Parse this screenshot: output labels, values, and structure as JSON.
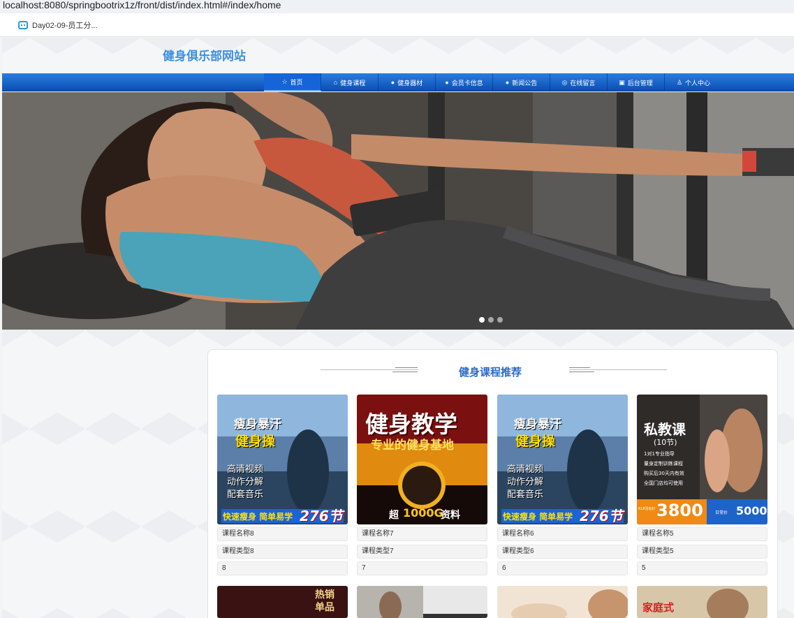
{
  "browser": {
    "url": "localhost:8080/springbootrix1z/front/dist/index.html#/index/home",
    "bookmark": "Day02-09-员工分..."
  },
  "site": {
    "title": "健身俱乐部网站"
  },
  "nav": [
    {
      "label": "首页",
      "icon": "star-icon"
    },
    {
      "label": "健身课程",
      "icon": "bag-icon"
    },
    {
      "label": "健身器材",
      "icon": "info-icon"
    },
    {
      "label": "会员卡信息",
      "icon": "question-icon"
    },
    {
      "label": "新闻公告",
      "icon": "info-icon"
    },
    {
      "label": "在线留言",
      "icon": "chat-icon"
    },
    {
      "label": "后台管理",
      "icon": "briefcase-icon"
    },
    {
      "label": "个人中心",
      "icon": "user-icon"
    }
  ],
  "carousel": {
    "dots": 3,
    "active_index": 0
  },
  "section": {
    "title": "健身课程推荐"
  },
  "courses": [
    {
      "name": "课程名称8",
      "type": "课程类型8",
      "value": "8",
      "poster": {
        "t1": "瘦身暴汗",
        "t2": "健身操",
        "t3": "高清视频",
        "t4": "动作分解",
        "t5": "配套音乐",
        "t6": "快速瘦身  简单易学",
        "t7": "276节"
      }
    },
    {
      "name": "课程名称7",
      "type": "课程类型7",
      "value": "7",
      "poster": {
        "t1": "健身教学",
        "t2": "专业的健身基地",
        "t3": "超",
        "t4": "1000G",
        "t5": "资料"
      }
    },
    {
      "name": "课程名称6",
      "type": "课程类型6",
      "value": "6",
      "poster": {
        "t1": "瘦身暴汗",
        "t2": "健身操",
        "t3": "高清视频",
        "t4": "动作分解",
        "t5": "配套音乐",
        "t6": "快速瘦身  简单易学",
        "t7": "276节"
      }
    },
    {
      "name": "课程名称5",
      "type": "课程类型5",
      "value": "5",
      "poster": {
        "t1": "私教课",
        "t2": "(10节)",
        "t3": "1对1专业指导",
        "t4": "量身定制训练课程",
        "t5": "购买后30天内有效",
        "t6": "全国门店均可使用",
        "t7": "3800",
        "t8": "5000",
        "t9": "日常价",
        "t10": "618活动价"
      }
    }
  ],
  "row2_posters": {
    "a1": "热销",
    "a2": "单品",
    "d1": "家庭式"
  }
}
